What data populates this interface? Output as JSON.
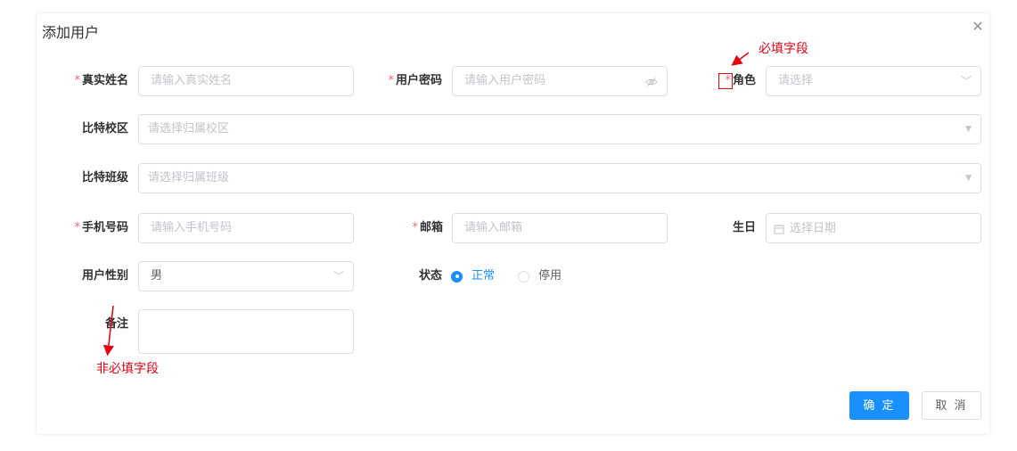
{
  "dialog": {
    "title": "添加用户",
    "close_icon": "close-icon"
  },
  "fields": {
    "real_name": {
      "label": "真实姓名",
      "required": "*",
      "placeholder": "请输入真实姓名"
    },
    "password": {
      "label": "用户密码",
      "required": "*",
      "placeholder": "请输入用户密码",
      "suffix_icon": "eye-off-icon"
    },
    "role": {
      "label": "角色",
      "required": "*",
      "placeholder": "请选择",
      "suffix_icon": "chevron-down-icon"
    },
    "campus": {
      "label": "比特校区",
      "placeholder": "请选择归属校区",
      "suffix_icon": "caret-down-icon"
    },
    "class": {
      "label": "比特班级",
      "placeholder": "请选择归属班级",
      "suffix_icon": "caret-down-icon"
    },
    "phone": {
      "label": "手机号码",
      "required": "*",
      "placeholder": "请输入手机号码"
    },
    "email": {
      "label": "邮箱",
      "required": "*",
      "placeholder": "请输入邮箱"
    },
    "birthday": {
      "label": "生日",
      "placeholder": "选择日期",
      "prefix_icon": "calendar-icon"
    },
    "gender": {
      "label": "用户性别",
      "value": "男",
      "suffix_icon": "chevron-down-icon"
    },
    "status": {
      "label": "状态",
      "options": [
        {
          "label": "正常",
          "checked": true
        },
        {
          "label": "停用",
          "checked": false
        }
      ]
    },
    "remark": {
      "label": "备注"
    }
  },
  "buttons": {
    "confirm": "确 定",
    "cancel": "取 消"
  },
  "annotations": {
    "required_note": "必填字段",
    "optional_note": "非必填字段"
  },
  "colors": {
    "primary": "#1890ff",
    "required_star": "#f56c6c",
    "annotation": "#e60012"
  }
}
